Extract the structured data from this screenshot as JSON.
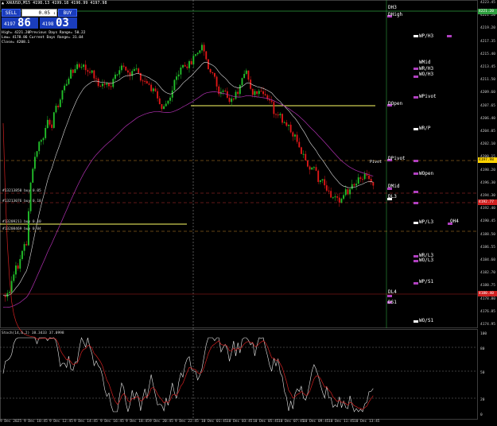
{
  "window": {
    "title": "▲ XAUUSD,M15  4198.13 4199.18 4196.99 4197.98"
  },
  "trade_panel": {
    "sell_label": "SELL",
    "buy_label": "BUY",
    "lot_value": "0.05",
    "bid_small": "4197",
    "bid_big": "86",
    "ask_small": "4198",
    "ask_big": "03"
  },
  "info_block": {
    "high": "High= 4221.20",
    "low": "Low= 4178.86",
    "close": "Close= 4208.1",
    "prev_range": "Previous Days Range= 50.22",
    "curr_range": "Current Days Range= 31.04"
  },
  "price_axis": {
    "ticks": [
      "4223.45",
      "4221.20",
      "4219.20",
      "4217.35",
      "4215.40",
      "4213.45",
      "4211.50",
      "4209.60",
      "4207.65",
      "4206.40",
      "4204.05",
      "4202.10",
      "4200.15",
      "4198.20",
      "4196.30",
      "4194.30",
      "4192.40",
      "4190.45",
      "4188.50",
      "4186.55",
      "4184.60",
      "4182.70",
      "4180.75",
      "4178.80",
      "4176.85",
      "4174.95"
    ],
    "current_price": "4197.98",
    "tag_high": "4221.20",
    "tag_dl4": "4180.40",
    "tag_order": "4192.77"
  },
  "levels": {
    "dh3": "DH3",
    "dhigh": "DHigh",
    "doopen": "DOpen",
    "dpivot": "DPivot",
    "dmid": "DMid",
    "dl3": "DL3",
    "dl4": "DL4",
    "ds1": "DS1",
    "wph3": "WP/H3",
    "wmid": "WMid",
    "wrh3": "WR/H3",
    "woh3": "WO/H3",
    "wpivot": "WPivot",
    "wrp": "WR/P",
    "wopen": "WOpen",
    "wpl3": "WP/L3",
    "oh4": "OH4",
    "wrl3": "WR/L3",
    "wol3": "WO/L3",
    "wps1": "WP/S1",
    "wos1": "WO/S1",
    "pivot_small": "Pivot"
  },
  "orders": {
    "o1": "#13213850 buy 0.05",
    "o2": "#13213076 buy 0.10",
    "o3": "#13209211 buy 0.10",
    "o4": "#13208469 buy 0.04"
  },
  "indicator": {
    "title": "Stoch(14,6,2) 38.3433 37.0998",
    "ticks": [
      "100",
      "80",
      "50",
      "20",
      "0"
    ]
  },
  "time_axis": {
    "labels": [
      "9 Dec 2025",
      "9 Dec 10:45",
      "9 Dec 12:45",
      "9 Dec 14:45",
      "9 Dec 16:45",
      "9 Dec 18:45",
      "9 Dec 20:45",
      "9 Dec 22:45",
      "10 Dec 01:45",
      "10 Dec 03:45",
      "10 Dec 05:45",
      "10 Dec 07:45",
      "10 Dec 09:45",
      "10 Dec 11:45",
      "10 Dec 13:45"
    ]
  },
  "colors": {
    "bull": "#22c02a",
    "bear": "#e01818",
    "level_green": "#2e9e3e",
    "level_yellow": "#ffff66",
    "dashed_orange": "#c88a2a",
    "dashed_red": "#c03030",
    "ma_magenta": "#b030b0",
    "ma_white": "#e0e0e0",
    "stoch_red": "#d02020"
  }
}
